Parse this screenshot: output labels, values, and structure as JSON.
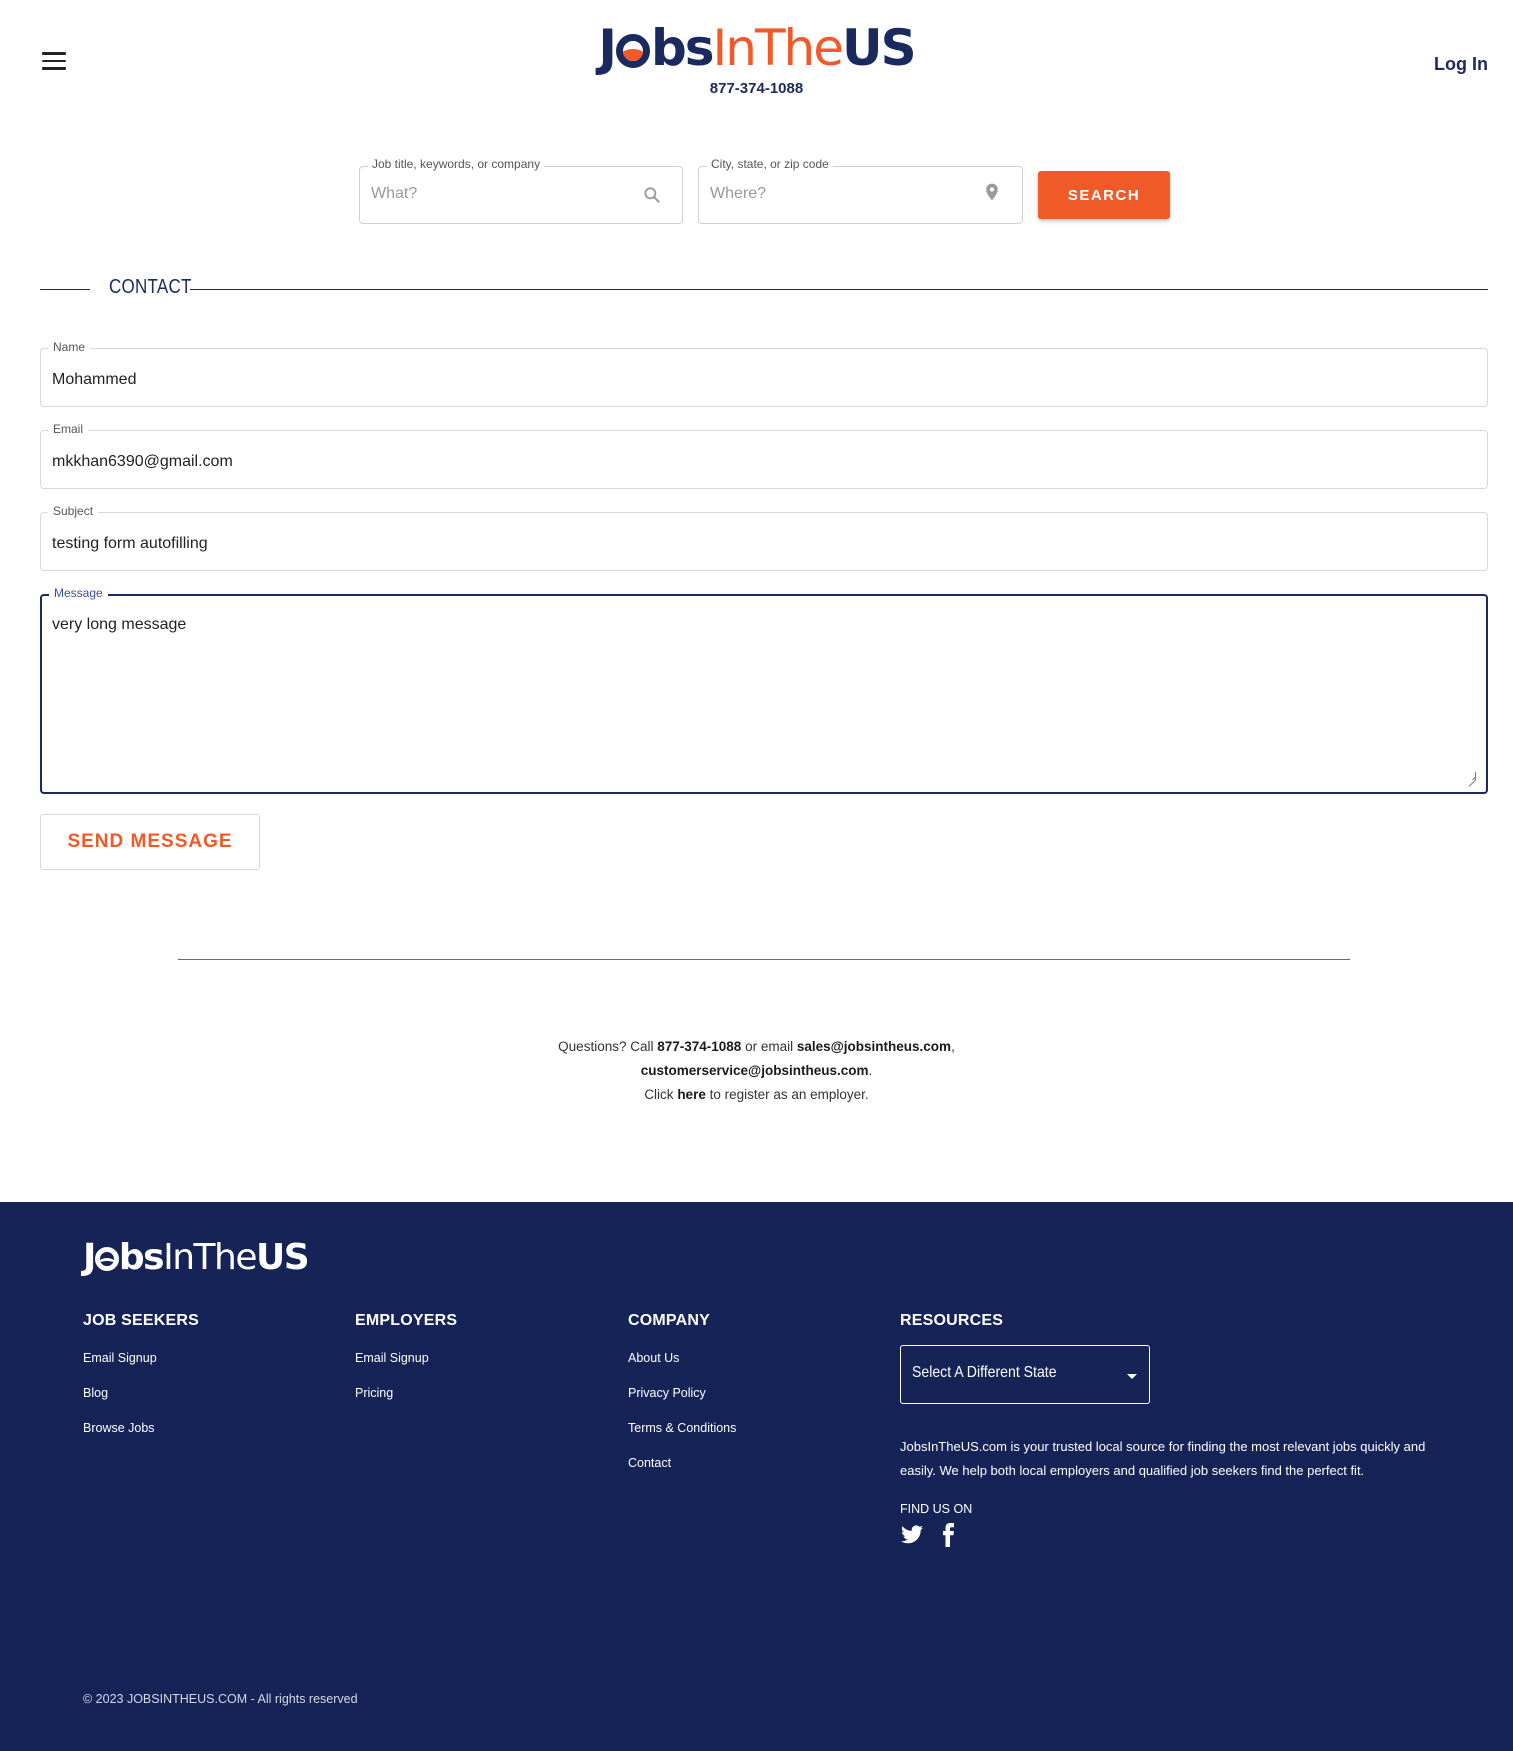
{
  "header": {
    "logo": {
      "part1_a": "J",
      "part1_b": "bs",
      "part2": "InThe",
      "part3": "US"
    },
    "phone": "877-374-1088",
    "login_label": "Log In"
  },
  "search": {
    "what_label": "Job title, keywords, or company",
    "what_placeholder": "What?",
    "where_label": "City, state, or zip code",
    "where_placeholder": "Where?",
    "button_label": "SEARCH"
  },
  "contact": {
    "title": "CONTACT",
    "fields": {
      "name": {
        "label": "Name",
        "value": "Mohammed"
      },
      "email": {
        "label": "Email",
        "value": "mkkhan6390@gmail.com"
      },
      "subject": {
        "label": "Subject",
        "value": "testing form autofilling"
      },
      "message": {
        "label": "Message",
        "value": "very long message"
      }
    },
    "send_label": "SEND MESSAGE"
  },
  "questions": {
    "line1_pre": "Questions? Call ",
    "phone": "877-374-1088",
    "line1_mid": " or email ",
    "sales_email": "sales@jobsintheus.com",
    "line1_post": ",",
    "cs_email": "customerservice@jobsintheus.com",
    "line2_post": ".",
    "line3_pre": "Click ",
    "here": "here",
    "line3_post": " to register as an employer."
  },
  "footer": {
    "logo": {
      "a": "J",
      "b": "bs",
      "c": "InThe",
      "d": "US"
    },
    "columns": [
      {
        "title": "JOB SEEKERS",
        "links": [
          "Email Signup",
          "Blog",
          "Browse Jobs"
        ]
      },
      {
        "title": "EMPLOYERS",
        "links": [
          "Email Signup",
          "Pricing"
        ]
      },
      {
        "title": "COMPANY",
        "links": [
          "About Us",
          "Privacy Policy",
          "Terms & Conditions",
          "Contact"
        ]
      }
    ],
    "resources": {
      "title": "RESOURCES",
      "select_value": "Select A Different State",
      "about": "JobsInTheUS.com is your trusted local source for finding the most relevant jobs quickly and easily. We help both local employers and qualified job seekers find the perfect fit.",
      "find_us": "FIND US ON",
      "social_icons": [
        "twitter-icon",
        "facebook-icon"
      ]
    },
    "copyright": "© 2023 JOBSINTHEUS.COM - All rights reserved"
  },
  "colors": {
    "navy": "#1b2a5e",
    "orange": "#ef5a28",
    "footer_bg": "#162356"
  }
}
